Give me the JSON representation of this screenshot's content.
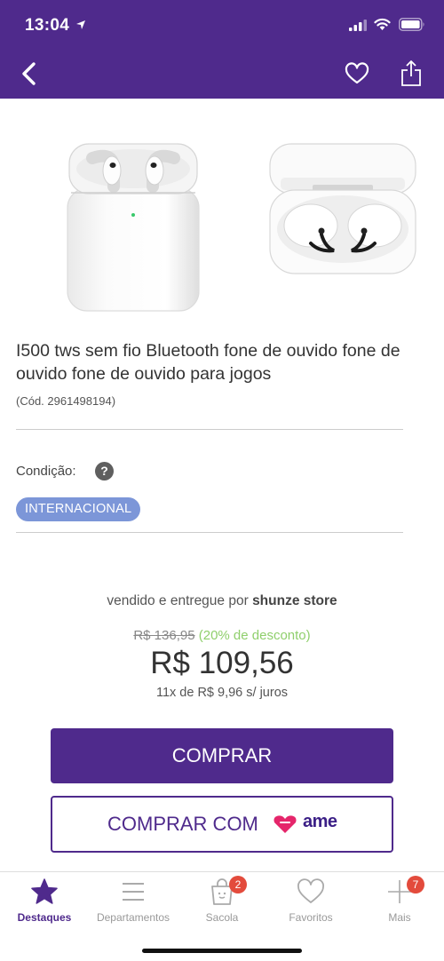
{
  "status_bar": {
    "time": "13:04",
    "icons": [
      "location-arrow-icon",
      "signal-icon",
      "wifi-icon",
      "battery-icon"
    ]
  },
  "nav": {
    "icons": [
      "back-chevron-icon",
      "heart-icon",
      "share-icon"
    ]
  },
  "product": {
    "title": "I500 tws sem fio Bluetooth fone de ouvido fone de ouvido fone de ouvido para jogos",
    "code": "(Cód. 2961498194)",
    "condition_label": "Condição:",
    "condition_help": "?",
    "condition_badge": "INTERNACIONAL"
  },
  "offer": {
    "seller_prefix": "vendido e entregue por ",
    "seller_name": "shunze store",
    "old_price": "R$ 136,95",
    "discount": "(20% de desconto)",
    "price": "R$ 109,56",
    "installments": "11x de R$ 9,96 s/ juros"
  },
  "actions": {
    "buy_label": "COMPRAR",
    "buy_with_label": "COMPRAR COM",
    "ame_brand": "ame"
  },
  "tabs": [
    {
      "label": "Destaques",
      "icon": "star-icon",
      "active": true
    },
    {
      "label": "Departamentos",
      "icon": "menu-lines-icon",
      "active": false
    },
    {
      "label": "Sacola",
      "icon": "shopping-bag-icon",
      "active": false,
      "badge": "2"
    },
    {
      "label": "Favoritos",
      "icon": "heart-outline-icon",
      "active": false
    },
    {
      "label": "Mais",
      "icon": "plus-icon",
      "active": false,
      "badge": "7"
    }
  ],
  "colors": {
    "primary": "#4f2a8c",
    "badge_blue": "#7c96d8",
    "discount_green": "#8fcf6c",
    "notification_red": "#e34b3c",
    "ame_pink": "#e5266b"
  }
}
